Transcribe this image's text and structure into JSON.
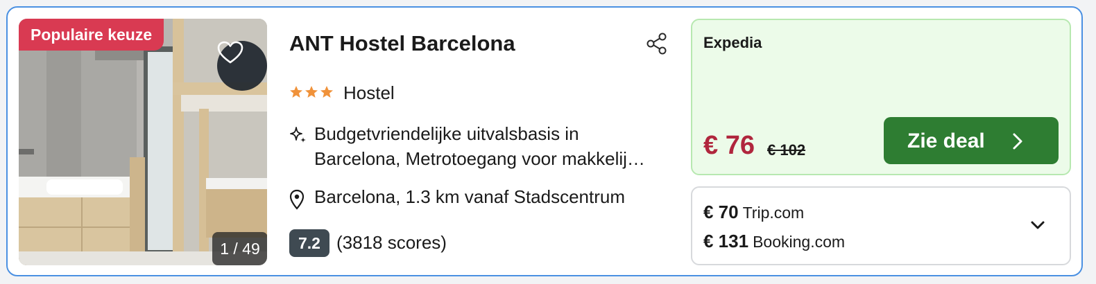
{
  "listing": {
    "badge": "Populaire keuze",
    "photo_counter": "1 / 49",
    "title": "ANT Hostel Barcelona",
    "stars": 3,
    "type": "Hostel",
    "description_line1": "Budgetvriendelijke uitvalsbasis in",
    "description_line2": "Barcelona, Metrotoegang voor makkelij…",
    "location": "Barcelona, 1.3 km vanaf Stadscentrum",
    "rating": "7.2",
    "review_count": "(3818 scores)"
  },
  "best_deal": {
    "provider": "Expedia",
    "price": "€ 76",
    "old_price": "€ 102",
    "button_label": "Zie deal"
  },
  "other_offers": [
    {
      "price": "€ 70",
      "provider": "Trip.com"
    },
    {
      "price": "€ 131",
      "provider": "Booking.com"
    }
  ],
  "icons": {
    "favorite": "heart-icon",
    "share": "share-icon",
    "star": "star-icon",
    "highlight": "sparkle-icon",
    "location": "map-pin-icon",
    "button_arrow": "chevron-right-icon",
    "expand": "chevron-down-icon"
  },
  "colors": {
    "badge": "#d93a52",
    "stars": "#f0923a",
    "deal_background": "#ecfbe9",
    "deal_price": "#b0263d",
    "button": "#2e7d32",
    "card_border": "#4a90e2",
    "score_badge": "#3f4a52"
  }
}
